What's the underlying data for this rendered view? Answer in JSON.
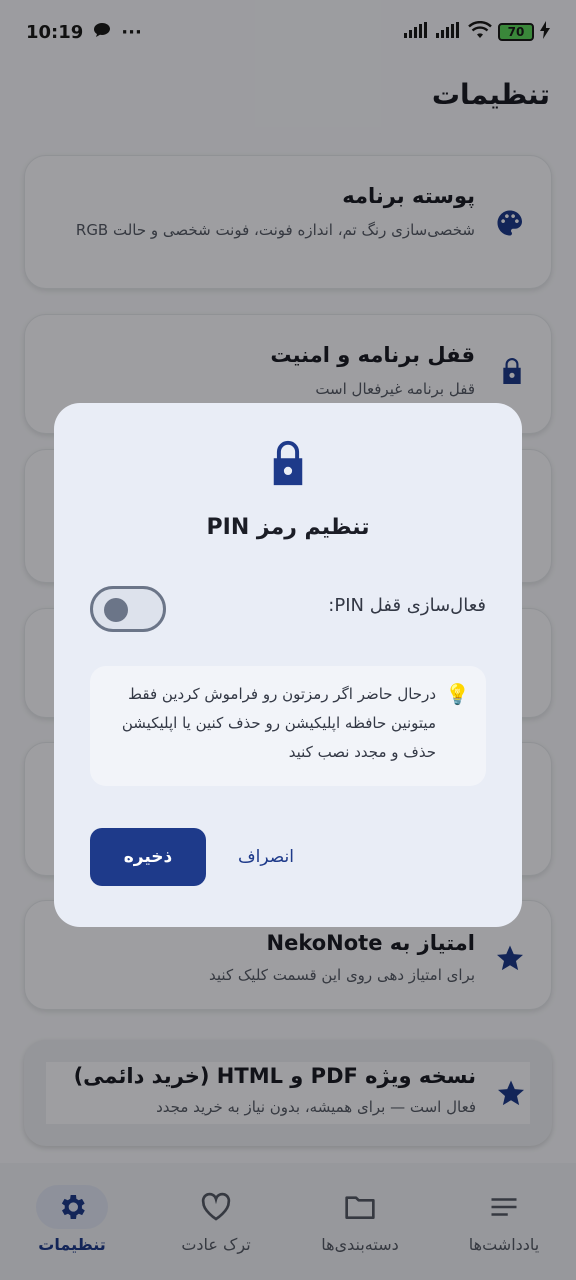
{
  "status_bar": {
    "time": "10:19",
    "dots": "···",
    "battery": "70"
  },
  "app": {
    "title": "تنظیمات"
  },
  "cards": [
    {
      "title": "پوسته برنامه",
      "subtitle": "شخصی‌سازی رنگ تم، اندازه فونت، فونت شخصی و حالت RGB",
      "icon": "palette-icon"
    },
    {
      "title": "قفل برنامه و امنیت",
      "subtitle": "قفل برنامه غیرفعال است",
      "icon": "lock-icon"
    },
    {
      "title": "امتیاز به NekoNote",
      "subtitle": "برای امتیاز دهی روی این قسمت کلیک کنید",
      "icon": "star-icon"
    },
    {
      "title": "نسخه ویژه PDF و HTML (خرید دائمی)",
      "subtitle": "فعال است — برای همیشه، بدون نیاز به خرید مجدد",
      "icon": "star-icon"
    }
  ],
  "dialog": {
    "title": "تنظیم رمز PIN",
    "toggle_label": "فعال‌سازی قفل PIN:",
    "toggle_on": false,
    "info_icon": "💡",
    "info_text": "درحال حاضر اگر رمزتون رو فراموش کردین فقط میتونین حافظه اپلیکیشن رو حذف کنین یا اپلیکیشن حذف و مجدد نصب کنید",
    "save_label": "ذخیره",
    "cancel_label": "انصراف"
  },
  "nav": {
    "items": [
      {
        "label": "یادداشت‌ها",
        "icon": "notes-icon"
      },
      {
        "label": "دسته‌بندی‌ها",
        "icon": "folder-icon"
      },
      {
        "label": "ترک عادت",
        "icon": "heart-icon"
      },
      {
        "label": "تنظیمات",
        "icon": "gear-icon",
        "active": true
      }
    ]
  },
  "colors": {
    "accent": "#1e3a8a",
    "background": "#f4f5fa",
    "dialog": "#e9edf6"
  }
}
